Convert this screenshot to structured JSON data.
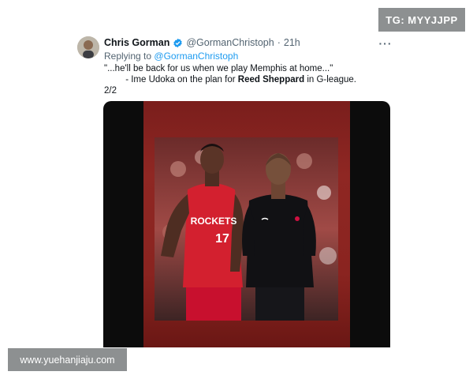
{
  "watermarks": {
    "top": "TG: MYYJJPP",
    "bottom": "www.yuehanjiaju.com"
  },
  "tweet": {
    "author_name": "Chris Gorman",
    "verified_icon": "verified-badge-icon",
    "handle": "@GormanChristoph",
    "separator": "·",
    "age": "21h",
    "more_icon": "more-options-icon",
    "more_glyph": "···",
    "replying_prefix": "Replying to",
    "replying_handle": "@GormanChristoph",
    "quote": "\"...he'll be back for us when we play Memphis at home...\"",
    "attribution_prefix": "- Ime Udoka on the plan for",
    "attribution_name": "Reed Sheppard",
    "attribution_suffix": "in G-league.",
    "thread_count": "2/2"
  },
  "media": {
    "jersey_text": "ROCKETS",
    "jersey_number": "17"
  },
  "colors": {
    "link": "#1d9bf0",
    "verified": "#1d9bf0",
    "secondary_text": "#536471",
    "rockets_red": "#ce1141",
    "watermark_bg": "#8d9091"
  }
}
